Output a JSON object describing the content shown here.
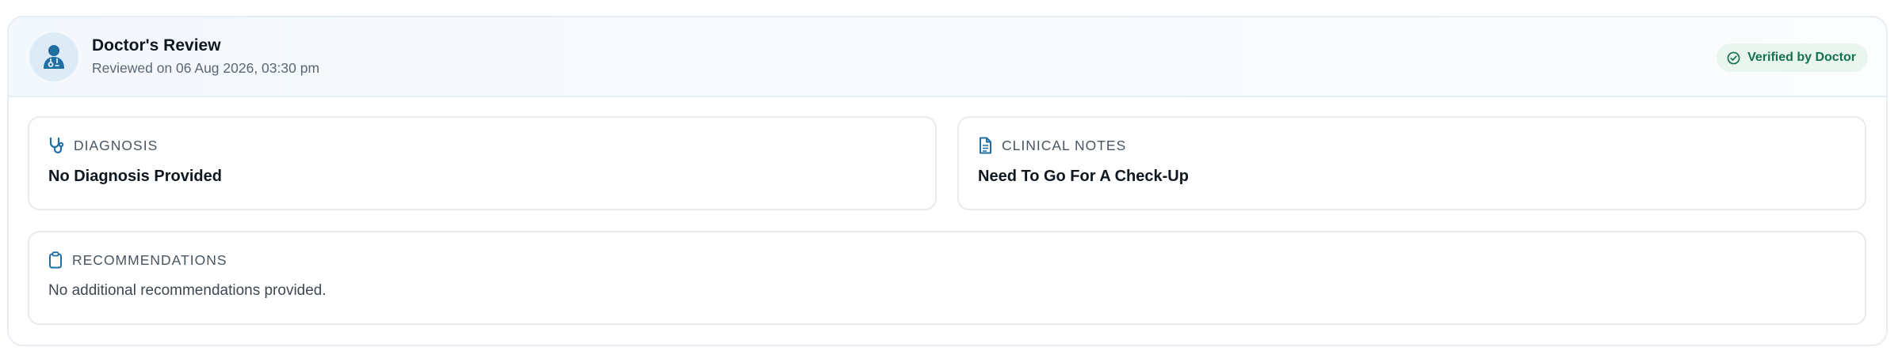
{
  "header": {
    "title": "Doctor's Review",
    "subtitle": "Reviewed on 06 Aug 2026, 03:30 pm",
    "badge": "Verified by Doctor",
    "avatar_icon": "doctor-icon",
    "badge_icon": "check-circle-icon"
  },
  "diagnosis": {
    "label": "DIAGNOSIS",
    "value": "No Diagnosis Provided",
    "icon": "stethoscope-icon"
  },
  "clinical_notes": {
    "label": "CLINICAL NOTES",
    "value": "Need To Go For A Check-Up",
    "icon": "document-icon"
  },
  "recommendations": {
    "label": "RECOMMENDATIONS",
    "value": "No additional recommendations provided.",
    "icon": "clipboard-icon"
  },
  "colors": {
    "accent": "#1f6fa5",
    "badge_bg": "#e9f6ef",
    "badge_text": "#15714a"
  }
}
